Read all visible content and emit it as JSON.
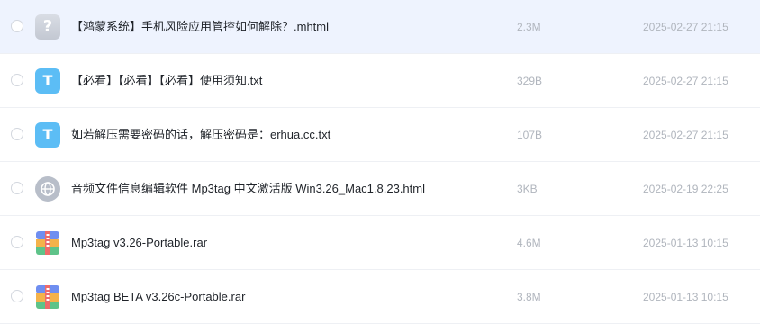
{
  "files": [
    {
      "name": "【鸿蒙系统】手机风险应用管控如何解除？.mhtml",
      "size": "2.3M",
      "date": "2025-02-27 21:15",
      "icon": "unknown-file-icon",
      "selected": true
    },
    {
      "name": "【必看】【必看】【必看】使用须知.txt",
      "size": "329B",
      "date": "2025-02-27 21:15",
      "icon": "text-file-icon",
      "selected": false
    },
    {
      "name": "如若解压需要密码的话，解压密码是：erhua.cc.txt",
      "size": "107B",
      "date": "2025-02-27 21:15",
      "icon": "text-file-icon",
      "selected": false
    },
    {
      "name": "音频文件信息编辑软件 Mp3tag 中文激活版 Win3.26_Mac1.8.23.html",
      "size": "3KB",
      "date": "2025-02-19 22:25",
      "icon": "web-file-icon",
      "selected": false
    },
    {
      "name": "Mp3tag v3.26-Portable.rar",
      "size": "4.6M",
      "date": "2025-01-13 10:15",
      "icon": "archive-file-icon",
      "selected": false
    },
    {
      "name": "Mp3tag BETA v3.26c-Portable.rar",
      "size": "3.8M",
      "date": "2025-01-13 10:15",
      "icon": "archive-file-icon",
      "selected": false
    }
  ],
  "glyphs": {
    "unknown": "?",
    "text": "T"
  },
  "colors": {
    "selected_row": "#eef3fe",
    "txt_icon": "#5cbdf5",
    "meta_text": "#b0b5bd"
  }
}
